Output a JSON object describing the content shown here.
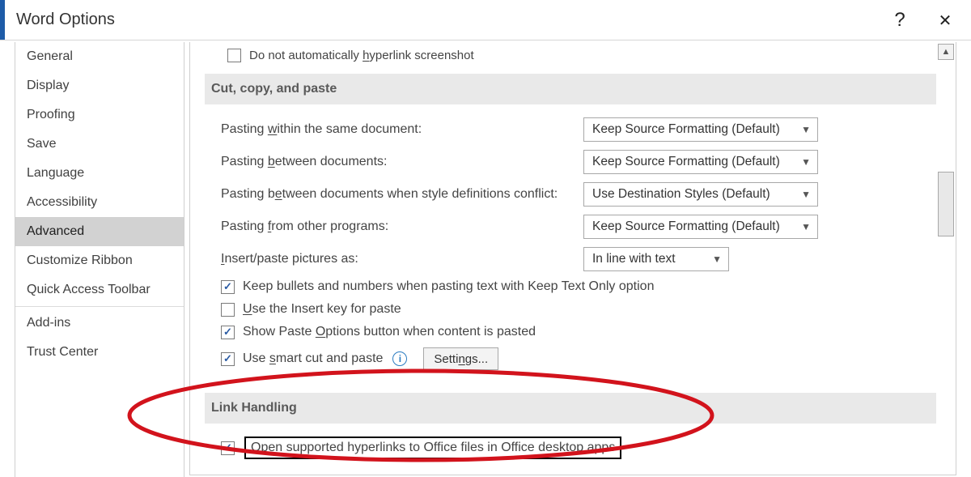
{
  "title": "Word Options",
  "help_symbol": "?",
  "close_symbol": "✕",
  "sidebar": {
    "items": [
      "General",
      "Display",
      "Proofing",
      "Save",
      "Language",
      "Accessibility",
      "Advanced",
      "Customize Ribbon",
      "Quick Access Toolbar",
      "Add-ins",
      "Trust Center"
    ]
  },
  "top_unchecked": {
    "prefix": "Do not automatically ",
    "underlined": "h",
    "suffix": "yperlink screenshot"
  },
  "section_cut": "Cut, copy, and paste",
  "paste_rows": [
    {
      "label_pre": "Pasting ",
      "ul": "w",
      "label_post": "ithin the same document:",
      "value": "Keep Source Formatting (Default)",
      "width": "lg"
    },
    {
      "label_pre": "Pasting ",
      "ul": "b",
      "label_post": "etween documents:",
      "value": "Keep Source Formatting (Default)",
      "width": "lg"
    },
    {
      "label_pre": "Pasting b",
      "ul": "e",
      "label_post": "tween documents when style definitions conflict:",
      "value": "Use Destination Styles (Default)",
      "width": "lg"
    },
    {
      "label_pre": "Pasting ",
      "ul": "f",
      "label_post": "rom other programs:",
      "value": "Keep Source Formatting (Default)",
      "width": "lg"
    },
    {
      "label_pre": "",
      "ul": "I",
      "label_post": "nsert/paste pictures as:",
      "value": "In line with text",
      "width": "md"
    }
  ],
  "check_lines": {
    "keep_bullets": "Keep bullets and numbers when pasting text with Keep Text Only option",
    "use_insert_pre": "",
    "use_insert_ul": "U",
    "use_insert_post": "se the Insert key for paste",
    "show_paste_pre": "Show Paste ",
    "show_paste_ul": "O",
    "show_paste_post": "ptions button when content is pasted",
    "smart_pre": "Use ",
    "smart_ul": "s",
    "smart_post": "mart cut and paste"
  },
  "settings_btn_pre": "Setti",
  "settings_btn_ul": "n",
  "settings_btn_post": "gs...",
  "section_link": "Link Handling",
  "link_checkbox_label": "Open supported hyperlinks to Office files in Office desktop apps"
}
